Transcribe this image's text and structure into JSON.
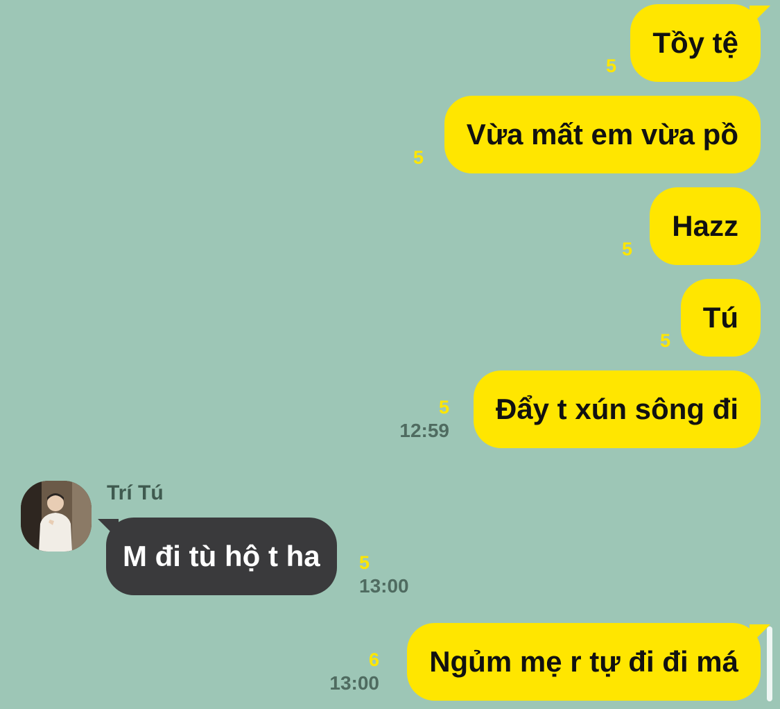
{
  "theme": {
    "background": "#9DC6B6",
    "outgoing_bubble": "#FFE600",
    "incoming_bubble": "#3A3A3C",
    "outgoing_text": "#111111",
    "incoming_text": "#FFFFFF",
    "unread_color": "#FFE600",
    "time_color": "#4F6B60"
  },
  "messages": [
    {
      "direction": "out",
      "text": "Tồy tệ",
      "unread": "5",
      "time": ""
    },
    {
      "direction": "out",
      "text": "Vừa mất em vừa pồ",
      "unread": "5",
      "time": ""
    },
    {
      "direction": "out",
      "text": "Hazz",
      "unread": "5",
      "time": ""
    },
    {
      "direction": "out",
      "text": "Tú",
      "unread": "5",
      "time": ""
    },
    {
      "direction": "out",
      "text": "Đẩy t xún sông đi",
      "unread": "5",
      "time": "12:59"
    },
    {
      "direction": "in",
      "sender": "Trí Tú",
      "avatar_icon": "profile-photo-icon",
      "text": "M đi tù hộ t ha",
      "unread": "5",
      "time": "13:00"
    },
    {
      "direction": "out",
      "text": "Ngủm mẹ r tự đi đi má",
      "unread": "6",
      "time": "13:00"
    }
  ]
}
